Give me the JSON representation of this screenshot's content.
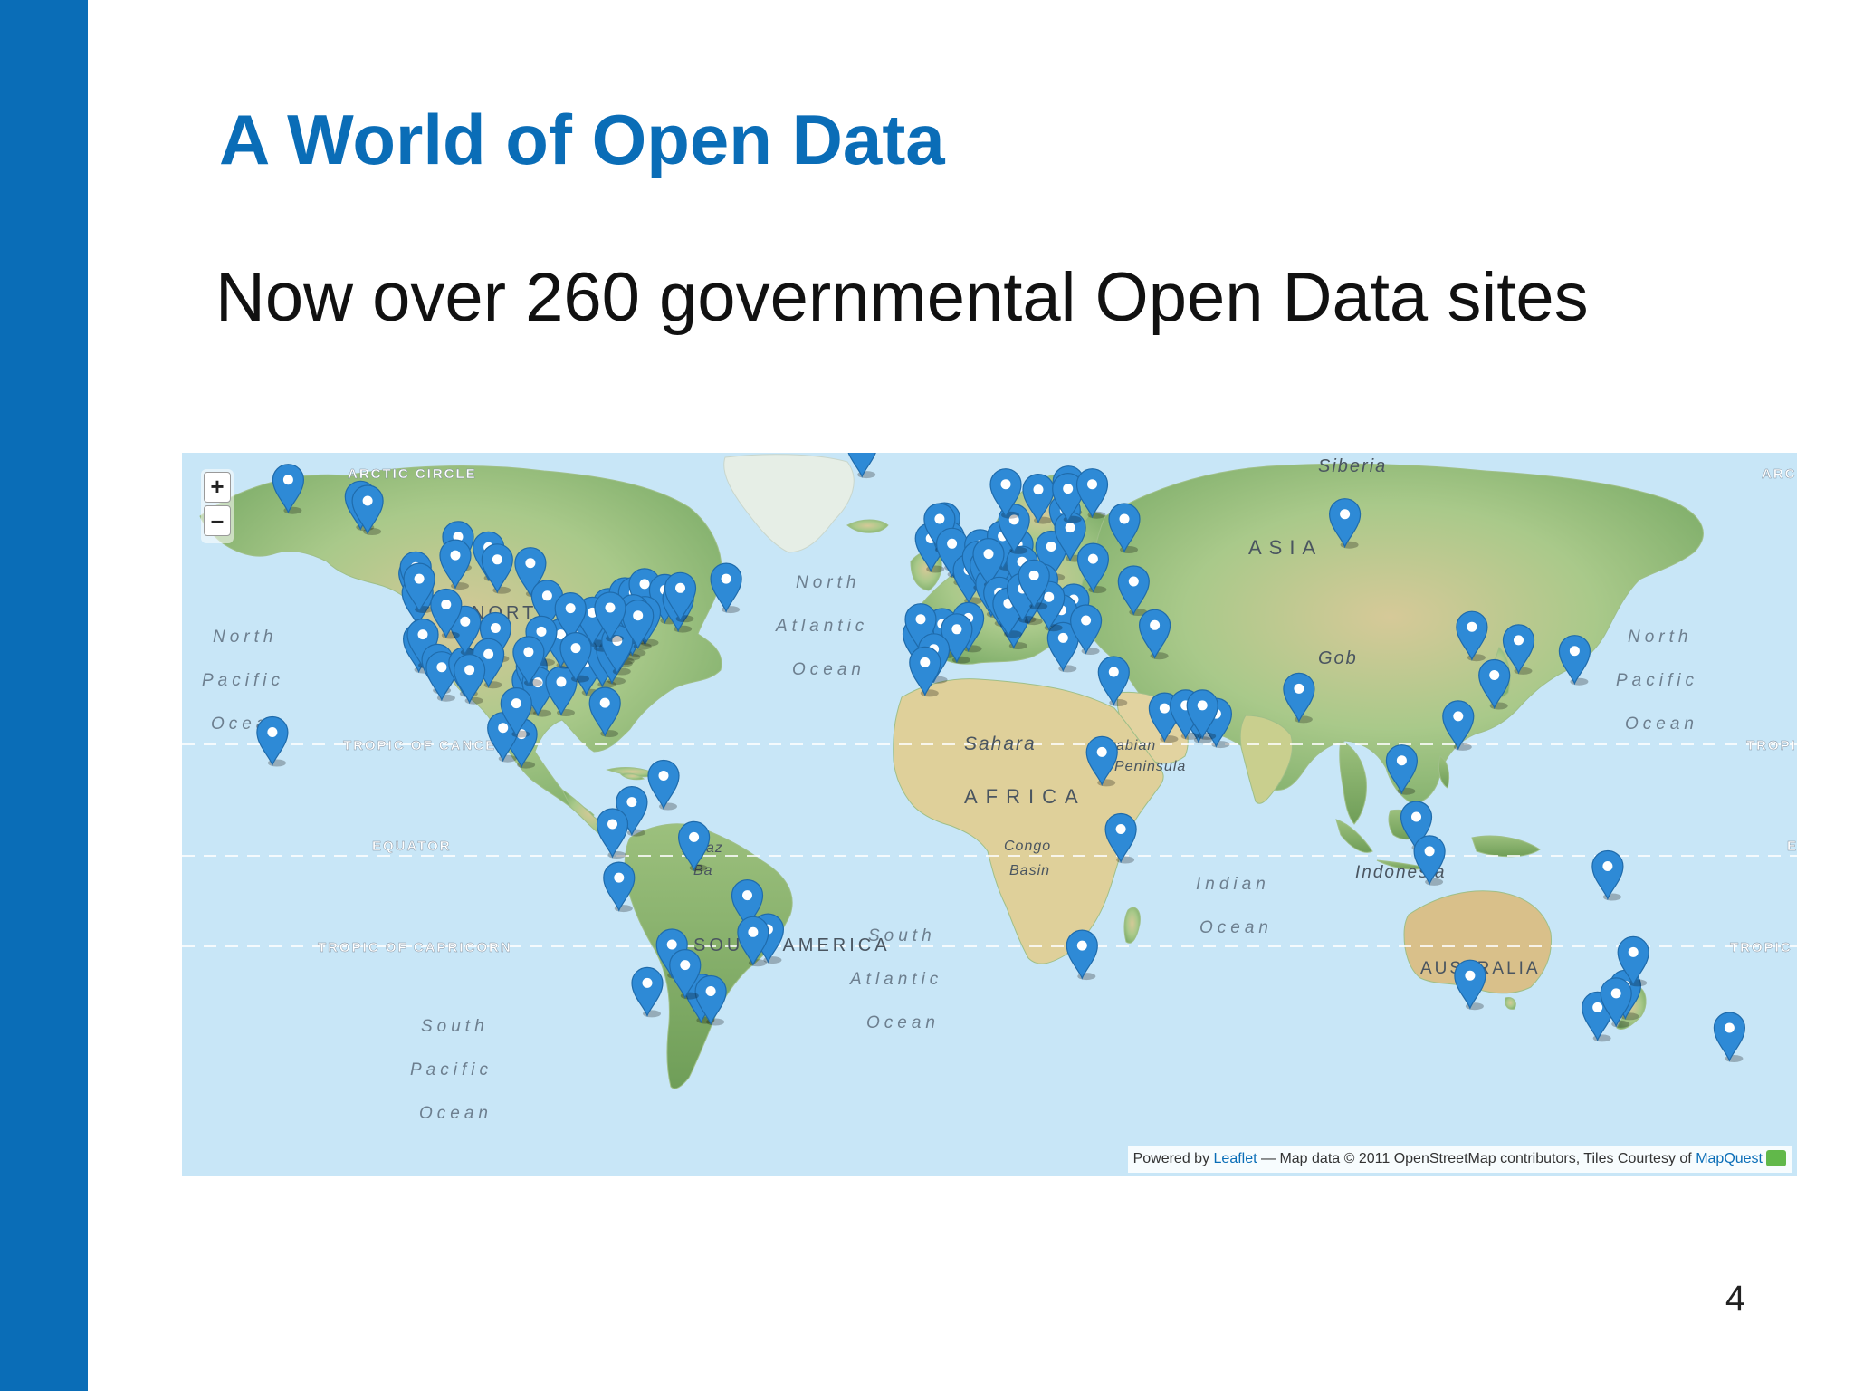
{
  "slide": {
    "title": "A World of Open Data",
    "body": "Now over 260 governmental Open Data sites",
    "page_number": "4",
    "accent_color": "#0a6db7"
  },
  "map": {
    "zoom_in_label": "+",
    "zoom_out_label": "–",
    "labels": {
      "arctic_circle": "ARCTIC CIRCLE",
      "arctic_right": "ARC",
      "tropic_cancer": "TROPIC OF CANCER",
      "tropic_right": "TROPI",
      "equator": "EQUATOR",
      "equator_right": "E",
      "tropic_capricorn": "TROPIC OF CAPRICORN",
      "tropic_capricorn_right": "TROPIC",
      "siberia": "Siberia",
      "asia": "ASIA",
      "gobi": "Gob",
      "sahara": "Sahara",
      "africa": "AFRICA",
      "arabian": "Arabian",
      "peninsula": "Peninsula",
      "congo": "Congo",
      "basin": "Basin",
      "amazon": "Amaz",
      "basin_sa": "Ba",
      "south_america": "SOUTH AMERICA",
      "indonesia": "Indonesia",
      "australia": "AUSTRALIA",
      "north_america": "NORTH AMERICA",
      "n_pacific_l": [
        "North",
        "Pacific",
        "Ocean"
      ],
      "n_pacific_r": [
        "North",
        "Pacific",
        "Ocean"
      ],
      "n_atlantic": [
        "North",
        "Atlantic",
        "Ocean"
      ],
      "s_atlantic": [
        "South",
        "Atlantic",
        "Ocean"
      ],
      "s_pacific": [
        "South",
        "Pacific",
        "Ocean"
      ],
      "indian": [
        "Indian",
        "Ocean"
      ]
    },
    "attribution": {
      "prefix": "Powered by ",
      "leaflet": "Leaflet",
      "middle": " — Map data © 2011 OpenStreetMap contributors, Tiles Courtesy of ",
      "mapquest": "MapQuest"
    },
    "marker_color": "#2e8ad6",
    "markers": [
      [
        -155.6,
        19.8
      ],
      [
        -152.0,
        60.4
      ],
      [
        -135.6,
        58.5
      ],
      [
        -134.0,
        58.0
      ],
      [
        -123.4,
        48.4
      ],
      [
        -123.1,
        49.3
      ],
      [
        -113.5,
        53.5
      ],
      [
        -114.1,
        51.0
      ],
      [
        -106.6,
        52.1
      ],
      [
        -104.6,
        50.4
      ],
      [
        -97.1,
        49.9
      ],
      [
        -79.4,
        43.7
      ],
      [
        -75.7,
        45.4
      ],
      [
        -73.6,
        45.5
      ],
      [
        -71.2,
        46.8
      ],
      [
        -66.6,
        45.9
      ],
      [
        -63.6,
        44.6
      ],
      [
        -63.1,
        46.2
      ],
      [
        -52.7,
        47.6
      ],
      [
        -122.7,
        45.5
      ],
      [
        -122.3,
        47.6
      ],
      [
        -122.4,
        37.8
      ],
      [
        -121.5,
        38.6
      ],
      [
        -118.2,
        34.1
      ],
      [
        -117.2,
        32.7
      ],
      [
        -112.1,
        33.5
      ],
      [
        -111.9,
        40.8
      ],
      [
        -116.2,
        43.6
      ],
      [
        -105.0,
        39.7
      ],
      [
        -106.6,
        35.1
      ],
      [
        -97.7,
        30.3
      ],
      [
        -96.8,
        32.8
      ],
      [
        -95.4,
        29.8
      ],
      [
        -90.1,
        29.9
      ],
      [
        -84.4,
        33.7
      ],
      [
        -87.6,
        41.9
      ],
      [
        -86.2,
        39.8
      ],
      [
        -83.0,
        40.0
      ],
      [
        -93.3,
        45.0
      ],
      [
        -90.2,
        38.6
      ],
      [
        -77.0,
        38.9
      ],
      [
        -76.6,
        39.3
      ],
      [
        -75.2,
        40.0
      ],
      [
        -74.0,
        40.7
      ],
      [
        -71.1,
        42.4
      ],
      [
        -73.8,
        42.7
      ],
      [
        -80.8,
        35.2
      ],
      [
        -78.6,
        35.8
      ],
      [
        -81.7,
        41.5
      ],
      [
        -83.0,
        42.3
      ],
      [
        -88.0,
        43.0
      ],
      [
        -94.6,
        39.1
      ],
      [
        -97.5,
        35.5
      ],
      [
        -80.2,
        25.8
      ],
      [
        -99.1,
        19.4
      ],
      [
        -103.3,
        20.7
      ],
      [
        -100.3,
        25.7
      ],
      [
        -110.9,
        32.2
      ],
      [
        -86.8,
        36.2
      ],
      [
        -77.4,
        37.5
      ],
      [
        -72.7,
        41.8
      ],
      [
        -79.0,
        43.1
      ],
      [
        -74.1,
        4.7
      ],
      [
        -77.0,
        -12.0
      ],
      [
        -78.5,
        -0.2
      ],
      [
        -66.9,
        10.5
      ],
      [
        -60.0,
        -3.1
      ],
      [
        -47.9,
        -15.8
      ],
      [
        -43.2,
        -22.9
      ],
      [
        -46.6,
        -23.5
      ],
      [
        -58.4,
        -34.6
      ],
      [
        -56.2,
        -34.9
      ],
      [
        -70.6,
        -33.4
      ],
      [
        -65.0,
        -26.0
      ],
      [
        -62.0,
        -30.0
      ],
      [
        -21.9,
        64.1
      ],
      [
        -0.1,
        51.5
      ],
      [
        -6.3,
        53.3
      ],
      [
        -3.2,
        55.9
      ],
      [
        -2.2,
        53.5
      ],
      [
        -4.3,
        55.8
      ],
      [
        -1.5,
        52.6
      ],
      [
        2.3,
        48.9
      ],
      [
        4.9,
        52.4
      ],
      [
        4.4,
        50.8
      ],
      [
        6.1,
        49.6
      ],
      [
        8.5,
        47.4
      ],
      [
        7.4,
        46.9
      ],
      [
        13.4,
        52.5
      ],
      [
        11.6,
        48.1
      ],
      [
        9.2,
        48.8
      ],
      [
        8.7,
        50.1
      ],
      [
        10.0,
        53.6
      ],
      [
        6.8,
        51.2
      ],
      [
        16.4,
        48.2
      ],
      [
        14.4,
        50.1
      ],
      [
        21.0,
        52.2
      ],
      [
        19.0,
        47.5
      ],
      [
        12.5,
        41.9
      ],
      [
        9.2,
        45.5
      ],
      [
        11.3,
        43.8
      ],
      [
        -3.7,
        40.4
      ],
      [
        2.2,
        41.4
      ],
      [
        -0.4,
        39.5
      ],
      [
        -9.1,
        38.7
      ],
      [
        -8.6,
        41.2
      ],
      [
        12.6,
        55.7
      ],
      [
        10.7,
        59.9
      ],
      [
        18.1,
        59.3
      ],
      [
        24.9,
        60.2
      ],
      [
        24.1,
        56.9
      ],
      [
        25.3,
        54.7
      ],
      [
        24.8,
        59.4
      ],
      [
        30.5,
        50.5
      ],
      [
        26.1,
        44.4
      ],
      [
        23.3,
        42.7
      ],
      [
        23.7,
        38.0
      ],
      [
        28.9,
        41.0
      ],
      [
        37.6,
        55.8
      ],
      [
        30.3,
        59.9
      ],
      [
        20.5,
        44.8
      ],
      [
        15.98,
        45.8
      ],
      [
        14.5,
        46.1
      ],
      [
        17.1,
        48.1
      ],
      [
        39.7,
        47.2
      ],
      [
        -5.6,
        36.0
      ],
      [
        -7.6,
        33.6
      ],
      [
        44.5,
        40.2
      ],
      [
        35.2,
        31.8
      ],
      [
        46.7,
        24.7
      ],
      [
        54.4,
        24.5
      ],
      [
        51.5,
        25.3
      ],
      [
        58.4,
        23.6
      ],
      [
        55.3,
        25.3
      ],
      [
        32.5,
        15.6
      ],
      [
        36.8,
        -1.3
      ],
      [
        28.0,
        -26.2
      ],
      [
        77.2,
        28.6
      ],
      [
        87.6,
        56.4
      ],
      [
        116.4,
        39.9
      ],
      [
        121.5,
        31.2
      ],
      [
        113.3,
        23.1
      ],
      [
        127.0,
        37.6
      ],
      [
        139.7,
        35.7
      ],
      [
        100.5,
        13.8
      ],
      [
        103.8,
        1.4
      ],
      [
        106.8,
        -6.2
      ],
      [
        147.2,
        -9.5
      ],
      [
        116.0,
        -32.0
      ],
      [
        144.9,
        -37.8
      ],
      [
        151.2,
        -33.9
      ],
      [
        153.0,
        -27.5
      ],
      [
        149.1,
        -35.3
      ],
      [
        174.8,
        -41.3
      ]
    ]
  }
}
